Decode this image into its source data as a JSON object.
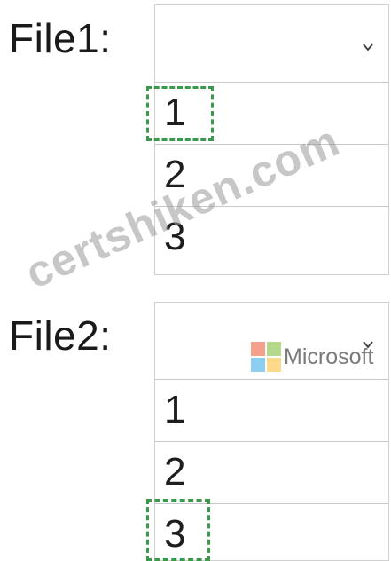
{
  "file1": {
    "label": "File1:",
    "selected_value": "",
    "options": [
      "1",
      "2",
      "3"
    ],
    "highlighted_option": "1"
  },
  "file2": {
    "label": "File2:",
    "selected_value": "",
    "options": [
      "1",
      "2",
      "3"
    ],
    "highlighted_option": "3"
  },
  "icons": {
    "dropdown": "chevron-down-icon"
  },
  "logo": {
    "text": "Microsoft",
    "colors": [
      "#f25022",
      "#7fba00",
      "#00a4ef",
      "#ffb900"
    ]
  },
  "watermark": {
    "text": "certshiken.com"
  },
  "colors": {
    "marker": "#3a9a4a",
    "border": "#c8c8c8"
  }
}
